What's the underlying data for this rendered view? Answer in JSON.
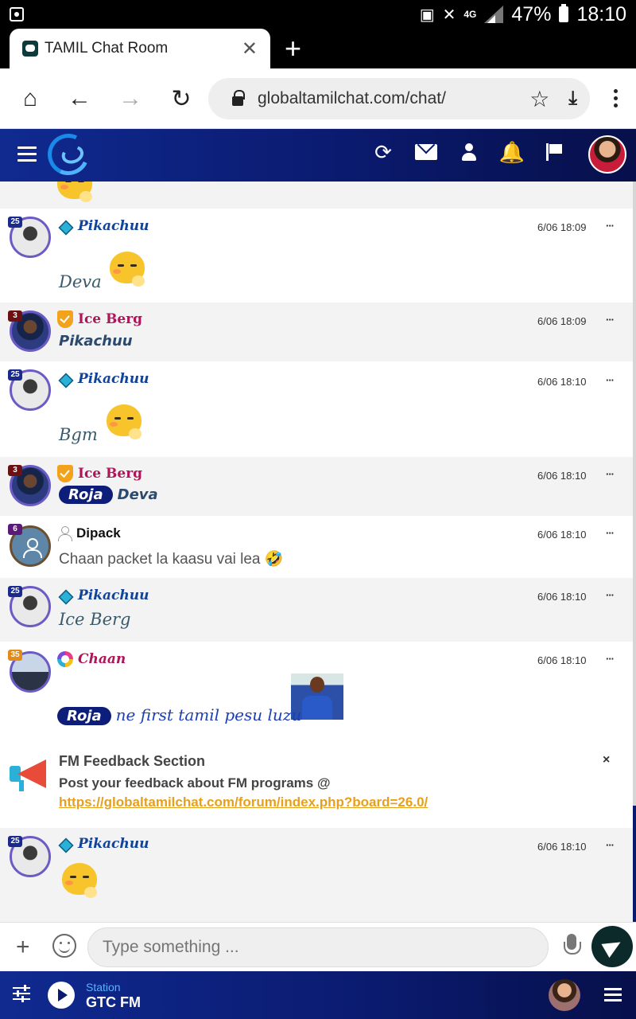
{
  "status_bar": {
    "battery": "47%",
    "time": "18:10",
    "network": "4G"
  },
  "browser": {
    "tab_title": "TAMIL Chat Room",
    "url": "globaltamilchat.com/chat/"
  },
  "messages": [
    {
      "user": "Pikachuu",
      "level": "25",
      "time": "6/06 18:09",
      "text": "Deva",
      "sticker": "pikachu-sticker"
    },
    {
      "user": "Ice Berg",
      "level": "3",
      "time": "6/06 18:09",
      "text": "Pikachuu"
    },
    {
      "user": "Pikachuu",
      "level": "25",
      "time": "6/06 18:10",
      "text": "Bgm",
      "sticker": "pikachu-sticker"
    },
    {
      "user": "Ice Berg",
      "level": "3",
      "time": "6/06 18:10",
      "tag": "Roja",
      "text": "Deva"
    },
    {
      "user": "Dipack",
      "level": "6",
      "time": "6/06 18:10",
      "text": "Chaan packet la kaasu vai lea",
      "emoji": "🤣"
    },
    {
      "user": "Pikachuu",
      "level": "25",
      "time": "6/06 18:10",
      "text": "Ice Berg"
    },
    {
      "user": "Chaan",
      "level": "35",
      "time": "6/06 18:10",
      "tag": "Roja",
      "text": "ne first tamil pesu luzu"
    },
    {
      "user": "Pikachuu",
      "level": "25",
      "time": "6/06 18:10",
      "sticker": "pikachu-sticker"
    }
  ],
  "more_label": "···",
  "fm_feedback": {
    "title": "FM Feedback Section",
    "body": "Post your feedback about FM programs @ ",
    "link": "https://globaltamilchat.com/forum/index.php?board=26.0/",
    "close": "×"
  },
  "input": {
    "placeholder": "Type something ..."
  },
  "player": {
    "label": "Station",
    "name": "GTC FM"
  },
  "colors": {
    "header": "#0a1a6e",
    "accent": "#e8a01b",
    "send": "#0c2a2a"
  }
}
